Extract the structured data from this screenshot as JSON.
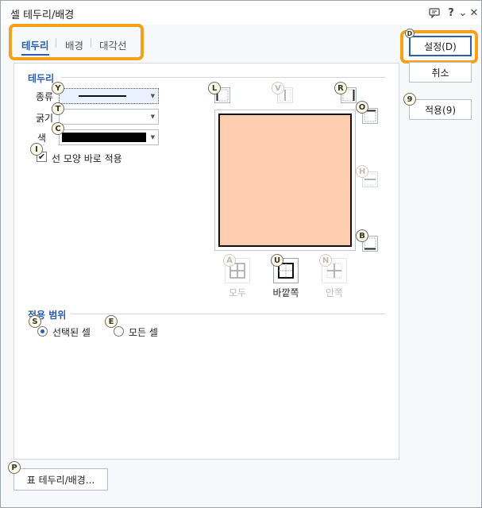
{
  "window": {
    "title": "셀 테두리/배경",
    "icons": [
      "comment-icon",
      "help-icon",
      "dropdown-icon",
      "close-icon"
    ],
    "help_glyph": "?",
    "close_glyph": "✕",
    "dropdown_glyph": "⌄"
  },
  "tabs": [
    {
      "label": "테두리",
      "active": true
    },
    {
      "label": "배경",
      "active": false
    },
    {
      "label": "대각선",
      "active": false
    }
  ],
  "border_section": {
    "title": "테두리",
    "type": {
      "label": "종류",
      "key": "Y"
    },
    "thickness": {
      "label": "굵기",
      "key": "T"
    },
    "color": {
      "label": "색",
      "key": "C",
      "value": "#000000"
    },
    "apply_immediately": {
      "label": "선 모양 바로 적용",
      "key": "I",
      "checked": true
    }
  },
  "preview": {
    "cell_color": "#ffcdb0",
    "keys": {
      "left": "L",
      "vertical": "V",
      "right": "R",
      "top": "O",
      "horizontal": "H",
      "bottom": "B"
    }
  },
  "presets": [
    {
      "key": "A",
      "label": "모두",
      "enabled": false
    },
    {
      "key": "U",
      "label": "바깥쪽",
      "enabled": true
    },
    {
      "key": "N",
      "label": "안쪽",
      "enabled": false
    }
  ],
  "scope_section": {
    "title": "적용 범위",
    "options": [
      {
        "key": "S",
        "label": "선택된 셀",
        "checked": true
      },
      {
        "key": "E",
        "label": "모든 셀",
        "checked": false
      }
    ]
  },
  "buttons": {
    "ok": "설정(D)",
    "ok_key": "D",
    "cancel": "취소",
    "apply": "적용(9)",
    "apply_key": "9",
    "table_border": "표 테두리/배경...",
    "table_border_key": "P"
  },
  "colors": {
    "accent": "#2b5fa8",
    "highlight": "#f5a11c"
  }
}
